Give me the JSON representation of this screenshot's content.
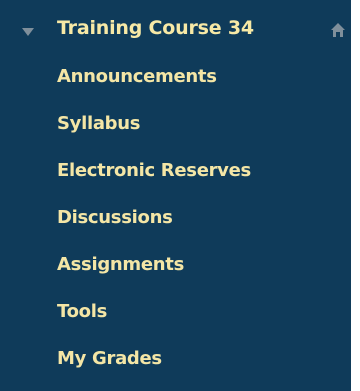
{
  "course": {
    "title": "Training Course 34",
    "chevron_icon": "chevron-down-icon",
    "home_icon": "home-icon"
  },
  "menu": {
    "items": [
      {
        "label": "Announcements"
      },
      {
        "label": "Syllabus"
      },
      {
        "label": "Electronic Reserves"
      },
      {
        "label": "Discussions"
      },
      {
        "label": "Assignments"
      },
      {
        "label": "Tools"
      },
      {
        "label": "My Grades"
      }
    ]
  },
  "colors": {
    "background": "#0f3b5a",
    "text": "#f4e6a6",
    "icon": "#7f8f9b"
  }
}
